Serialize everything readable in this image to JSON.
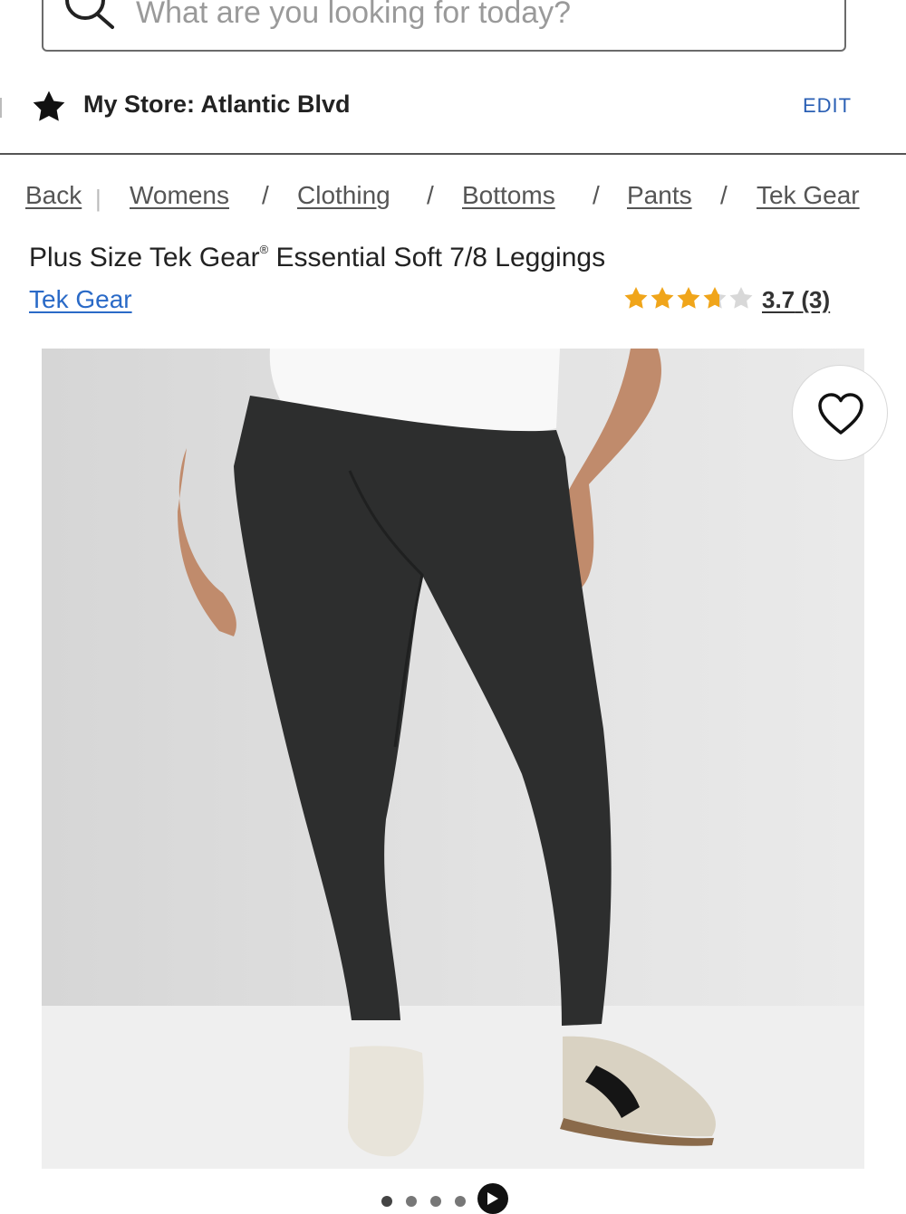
{
  "search": {
    "placeholder": "What are you looking for today?"
  },
  "store": {
    "label": "My Store: Atlantic Blvd",
    "edit_label": "EDIT"
  },
  "breadcrumb": {
    "back": "Back",
    "items": [
      "Womens",
      "Clothing",
      "Bottoms",
      "Pants",
      "Tek Gear"
    ],
    "separator": "/"
  },
  "product": {
    "title_pre": "Plus Size Tek Gear",
    "title_mark": "®",
    "title_post": " Essential Soft 7/8 Leggings",
    "brand": "Tek Gear",
    "rating": 3.7,
    "rating_text": "3.7",
    "review_count_text": "(3)"
  },
  "carousel": {
    "slide_count": 4,
    "active_index": 0
  },
  "colors": {
    "accent": "#2a5fb4",
    "star": "#f0a51a",
    "star_empty": "#d8d8d8"
  },
  "icons": {
    "search": "search-icon",
    "store": "star-icon",
    "favorite": "heart-icon",
    "video": "play-icon"
  }
}
